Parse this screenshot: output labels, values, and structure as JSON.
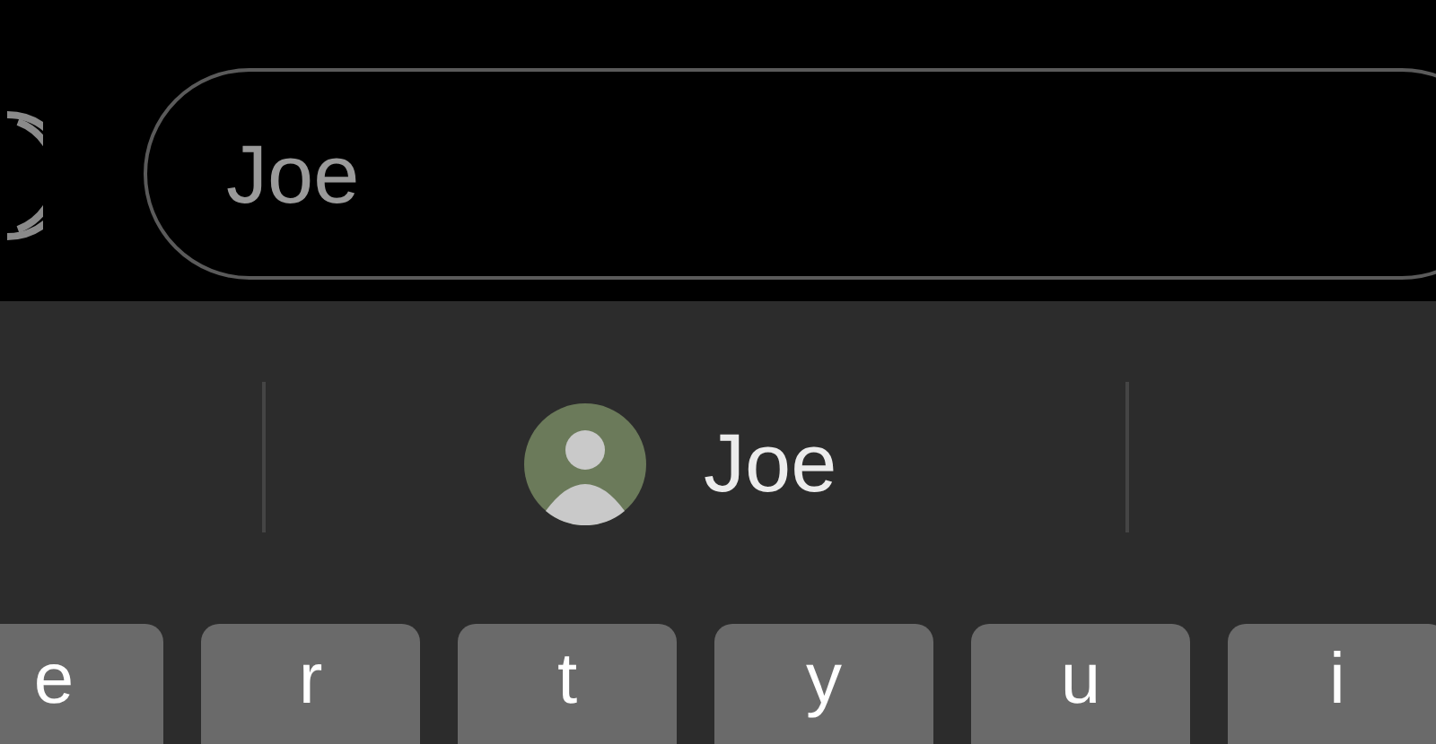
{
  "search_field": {
    "value": "Joe"
  },
  "suggestions": [
    {
      "label": "Joe"
    }
  ],
  "keys": [
    {
      "label": "e"
    },
    {
      "label": "r"
    },
    {
      "label": "t"
    },
    {
      "label": "y"
    },
    {
      "label": "u"
    },
    {
      "label": "i"
    }
  ]
}
